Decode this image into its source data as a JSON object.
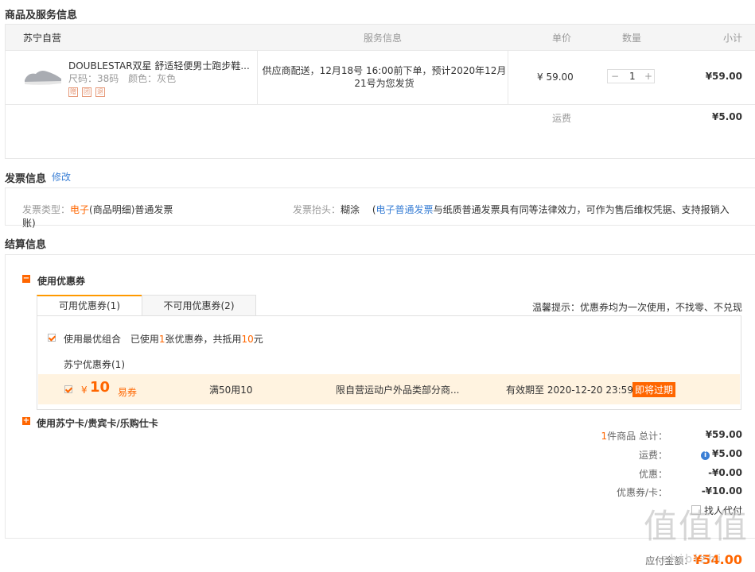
{
  "section1": {
    "title": "商品及服务信息"
  },
  "table": {
    "headers": {
      "store": "苏宁自营",
      "service": "服务信息",
      "price": "单价",
      "qty": "数量",
      "subtotal": "小计"
    },
    "product": {
      "name": "DOUBLESTAR双星 舒适轻便男士跑步鞋...",
      "size_label": "尺码：38码",
      "color_label": "颜色：灰色",
      "badges": [
        "赠",
        "团",
        "退"
      ],
      "service_text": "供应商配送，12月18号 16:00前下单，预计2020年12月21号为您发货",
      "price": "¥ 59.00",
      "qty_minus": "−",
      "qty": "1",
      "qty_plus": "+",
      "subtotal": "¥59.00"
    },
    "shipping_label": "运费",
    "shipping_value": "¥5.00"
  },
  "invoice": {
    "title": "发票信息",
    "edit_link": "修改",
    "type_label": "发票类型：",
    "type_highlight": "电子",
    "type_value": "(商品明细)普通发票",
    "type_wrap": "账)",
    "head_label": "发票抬头：",
    "head_value": "糊涂",
    "note_prefix": "(",
    "note_link": "电子普通发票",
    "note_text": "与纸质普通发票具有同等法律效力，可作为售后维权凭据、支持报销入"
  },
  "settlement": {
    "title": "结算信息",
    "coupon_section": "使用优惠券",
    "tab_available": "可用优惠券(1)",
    "tab_unavailable": "不可用优惠券(2)",
    "tip": "温馨提示：优惠券均为一次使用，不找零、不兑现",
    "best_combo": "使用最优组合",
    "used_pre": "已使用",
    "used_count": "1",
    "used_mid": "张优惠券，共抵用",
    "used_amount": "10",
    "used_unit": "元",
    "group_name": "苏宁优惠券(1)",
    "coupon": {
      "currency": "¥",
      "amount": "10",
      "type": "易券",
      "condition": "满50用10",
      "scope": "限自营运动户外品类部分商...",
      "validity": "有效期至 2020-12-20 23:59",
      "expiring": "即将过期"
    },
    "card_section": "使用苏宁卡/贵宾卡/乐购仕卡"
  },
  "summary": {
    "count": "1",
    "count_label": "件商品 总计：",
    "total": "¥59.00",
    "shipping_label": "运费：",
    "shipping": "¥5.00",
    "discount_label": "优惠：",
    "discount": "-¥0.00",
    "coupon_label": "优惠券/卡：",
    "coupon": "-¥10.00",
    "proxy_pay": "找人代付",
    "payable_label": "应付金额：",
    "payable": "¥54.00"
  },
  "watermark": {
    "text": "值值值",
    "url": "zhibizhi"
  },
  "colors": {
    "accent": "#ff6600",
    "link": "#3a7fd5",
    "coupon_bg": "#fff3e0"
  }
}
